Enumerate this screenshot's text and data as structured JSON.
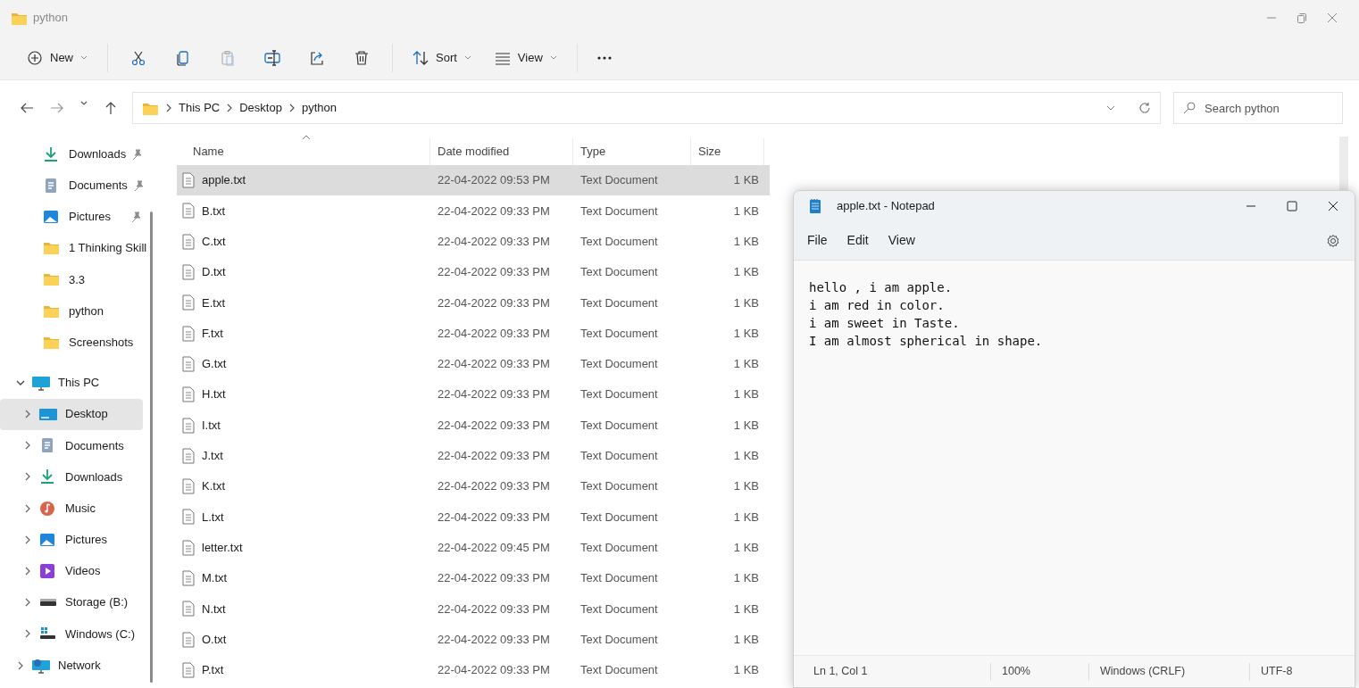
{
  "window": {
    "title": "python"
  },
  "toolbar": {
    "items": [
      {
        "kind": "new",
        "label": "New",
        "disabled": false
      },
      {
        "kind": "cut",
        "disabled": false
      },
      {
        "kind": "copy",
        "disabled": false
      },
      {
        "kind": "paste",
        "disabled": true
      },
      {
        "kind": "rename",
        "disabled": false
      },
      {
        "kind": "share",
        "disabled": false
      },
      {
        "kind": "delete",
        "disabled": false
      },
      {
        "kind": "sort",
        "label": "Sort",
        "disabled": false
      },
      {
        "kind": "view",
        "label": "View",
        "disabled": false
      },
      {
        "kind": "more",
        "disabled": false
      }
    ]
  },
  "address_bar": {
    "path": [
      "This PC",
      "Desktop",
      "python"
    ],
    "search": {
      "placeholder": "Search python"
    }
  },
  "sidebar": {
    "items": [
      {
        "kind": "downloads",
        "label": "Downloads",
        "pinned": true,
        "selected": false
      },
      {
        "kind": "documents",
        "label": "Documents",
        "pinned": true,
        "selected": false
      },
      {
        "kind": "pictures",
        "label": "Pictures",
        "pinned": true,
        "selected": false
      },
      {
        "kind": "folder",
        "label": "1 Thinking Skill",
        "pinned": false,
        "selected": false
      },
      {
        "kind": "folder",
        "label": "3.3",
        "pinned": false,
        "selected": false
      },
      {
        "kind": "folder",
        "label": "python",
        "pinned": false,
        "selected": false
      },
      {
        "kind": "folder",
        "label": "Screenshots",
        "pinned": false,
        "selected": false
      },
      {
        "kind": "pc",
        "label": "This PC",
        "expanded": true,
        "selected": false,
        "children": [
          {
            "kind": "desktop",
            "label": "Desktop",
            "expanded": false,
            "selected": true
          },
          {
            "kind": "documents",
            "label": "Documents",
            "expanded": false,
            "selected": false
          },
          {
            "kind": "downloads",
            "label": "Downloads",
            "expanded": false,
            "selected": false
          },
          {
            "kind": "music",
            "label": "Music",
            "expanded": false,
            "selected": false
          },
          {
            "kind": "pictures",
            "label": "Pictures",
            "expanded": false,
            "selected": false
          },
          {
            "kind": "videos",
            "label": "Videos",
            "expanded": false,
            "selected": false
          },
          {
            "kind": "drive",
            "label": "Storage (B:)",
            "expanded": false,
            "selected": false
          },
          {
            "kind": "windrive",
            "label": "Windows (C:)",
            "expanded": false,
            "selected": false
          }
        ]
      },
      {
        "kind": "network",
        "label": "Network",
        "expanded": false,
        "selected": false
      }
    ]
  },
  "table": {
    "columns": [
      "Name",
      "Date modified",
      "Type",
      "Size"
    ],
    "rows": [
      {
        "name": "apple.txt",
        "date": "22-04-2022 09:53 PM",
        "type": "Text Document",
        "size": "1 KB",
        "selected": true
      },
      {
        "name": "B.txt",
        "date": "22-04-2022 09:33 PM",
        "type": "Text Document",
        "size": "1 KB",
        "selected": false
      },
      {
        "name": "C.txt",
        "date": "22-04-2022 09:33 PM",
        "type": "Text Document",
        "size": "1 KB",
        "selected": false
      },
      {
        "name": "D.txt",
        "date": "22-04-2022 09:33 PM",
        "type": "Text Document",
        "size": "1 KB",
        "selected": false
      },
      {
        "name": "E.txt",
        "date": "22-04-2022 09:33 PM",
        "type": "Text Document",
        "size": "1 KB",
        "selected": false
      },
      {
        "name": "F.txt",
        "date": "22-04-2022 09:33 PM",
        "type": "Text Document",
        "size": "1 KB",
        "selected": false
      },
      {
        "name": "G.txt",
        "date": "22-04-2022 09:33 PM",
        "type": "Text Document",
        "size": "1 KB",
        "selected": false
      },
      {
        "name": "H.txt",
        "date": "22-04-2022 09:33 PM",
        "type": "Text Document",
        "size": "1 KB",
        "selected": false
      },
      {
        "name": "I.txt",
        "date": "22-04-2022 09:33 PM",
        "type": "Text Document",
        "size": "1 KB",
        "selected": false
      },
      {
        "name": "J.txt",
        "date": "22-04-2022 09:33 PM",
        "type": "Text Document",
        "size": "1 KB",
        "selected": false
      },
      {
        "name": "K.txt",
        "date": "22-04-2022 09:33 PM",
        "type": "Text Document",
        "size": "1 KB",
        "selected": false
      },
      {
        "name": "L.txt",
        "date": "22-04-2022 09:33 PM",
        "type": "Text Document",
        "size": "1 KB",
        "selected": false
      },
      {
        "name": "letter.txt",
        "date": "22-04-2022 09:45 PM",
        "type": "Text Document",
        "size": "1 KB",
        "selected": false
      },
      {
        "name": "M.txt",
        "date": "22-04-2022 09:33 PM",
        "type": "Text Document",
        "size": "1 KB",
        "selected": false
      },
      {
        "name": "N.txt",
        "date": "22-04-2022 09:33 PM",
        "type": "Text Document",
        "size": "1 KB",
        "selected": false
      },
      {
        "name": "O.txt",
        "date": "22-04-2022 09:33 PM",
        "type": "Text Document",
        "size": "1 KB",
        "selected": false
      },
      {
        "name": "P.txt",
        "date": "22-04-2022 09:33 PM",
        "type": "Text Document",
        "size": "1 KB",
        "selected": false
      }
    ]
  },
  "notepad": {
    "title": "apple.txt - Notepad",
    "menu": [
      "File",
      "Edit",
      "View"
    ],
    "lines": [
      "hello , i am apple.",
      "i am red in color.",
      "i am sweet in Taste.",
      "I am almost spherical in shape."
    ],
    "status_bar": [
      "Ln 1, Col 1",
      "100%",
      "Windows (CRLF)",
      "UTF-8"
    ]
  }
}
